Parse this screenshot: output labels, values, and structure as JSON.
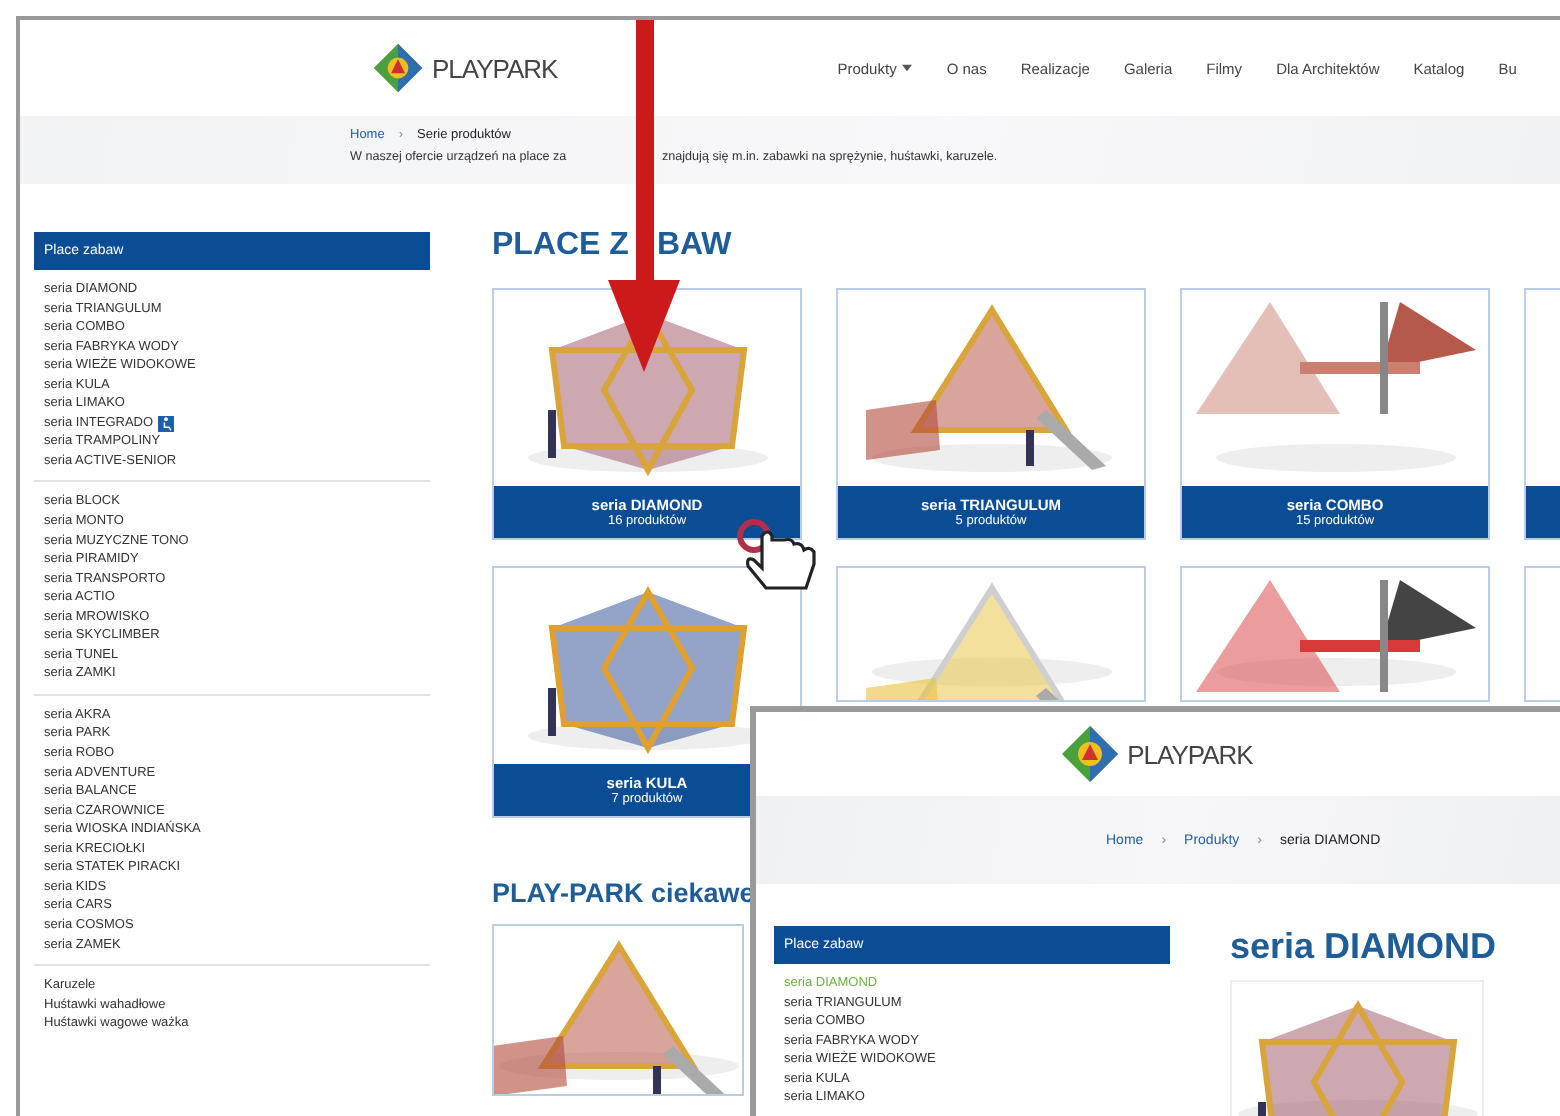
{
  "header": {
    "logo": "**PLAY**PARK",
    "nav": [
      {
        "label": "Produkty",
        "dropdown": true
      },
      {
        "label": "O nas",
        "dropdown": false
      },
      {
        "label": "Realizacje",
        "dropdown": false
      },
      {
        "label": "Galeria",
        "dropdown": false
      },
      {
        "label": "Filmy",
        "dropdown": false
      },
      {
        "label": "Dla Architektów",
        "dropdown": false
      },
      {
        "label": "Katalog",
        "dropdown": false
      },
      {
        "label": "Bu",
        "dropdown": false
      }
    ]
  },
  "breadcrumb": {
    "separator": "›",
    "items": [
      "Home",
      "Serie produktów"
    ]
  },
  "intro": [
    "W naszej ofercie urządzeń na place za",
    "znajdują się m.in. zabawki na sprężynie, huśtawki, karuzele."
  ],
  "sidebar": {
    "title": "Place zabaw",
    "groups": [
      [
        {
          "label": "seria DIAMOND",
          "accessible": false
        },
        {
          "label": "seria TRIANGULUM",
          "accessible": false
        },
        {
          "label": "seria COMBO",
          "accessible": false
        },
        {
          "label": "seria FABRYKA WODY",
          "accessible": false
        },
        {
          "label": "seria WIEŻE WIDOKOWE",
          "accessible": false
        },
        {
          "label": "seria KULA",
          "accessible": false
        },
        {
          "label": "seria LIMAKO",
          "accessible": false
        },
        {
          "label": "seria INTEGRADO",
          "accessible": true
        },
        {
          "label": "seria TRAMPOLINY",
          "accessible": false
        },
        {
          "label": "seria ACTIVE-SENIOR",
          "accessible": false
        }
      ],
      [
        {
          "label": "seria BLOCK",
          "accessible": false
        },
        {
          "label": "seria MONTO",
          "accessible": false
        },
        {
          "label": "seria MUZYCZNE TONO",
          "accessible": false
        },
        {
          "label": "seria PIRAMIDY",
          "accessible": false
        },
        {
          "label": "seria TRANSPORTO",
          "accessible": false
        },
        {
          "label": "seria ACTIO",
          "accessible": false
        },
        {
          "label": "seria MROWISKO",
          "accessible": false
        },
        {
          "label": "seria SKYCLIMBER",
          "accessible": false
        },
        {
          "label": "seria TUNEL",
          "accessible": false
        },
        {
          "label": "seria ZAMKI",
          "accessible": false
        }
      ],
      [
        {
          "label": "seria AKRA",
          "accessible": false
        },
        {
          "label": "seria PARK",
          "accessible": false
        },
        {
          "label": "seria ROBO",
          "accessible": false
        },
        {
          "label": "seria ADVENTURE",
          "accessible": false
        },
        {
          "label": "seria BALANCE",
          "accessible": false
        },
        {
          "label": "seria CZAROWNICE",
          "accessible": false
        },
        {
          "label": "seria WIOSKA INDIAŃSKA",
          "accessible": false
        },
        {
          "label": "seria KRECIOŁKI",
          "accessible": false
        },
        {
          "label": "seria STATEK PIRACKI",
          "accessible": false
        },
        {
          "label": "seria KIDS",
          "accessible": false
        },
        {
          "label": "seria CARS",
          "accessible": false
        },
        {
          "label": "seria COSMOS",
          "accessible": false
        },
        {
          "label": "seria ZAMEK",
          "accessible": false
        }
      ],
      [
        {
          "label": "Karuzele",
          "accessible": false
        },
        {
          "label": "Huśtawki wahadłowe",
          "accessible": false
        },
        {
          "label": "Huśtawki wagowe ważka",
          "accessible": false
        }
      ]
    ]
  },
  "section_title": [
    "PLACE Z",
    "BAW"
  ],
  "cards": [
    {
      "kind": "caption",
      "title": "seria DIAMOND",
      "count": "16 produktów"
    },
    {
      "kind": "caption",
      "title": "seria TRIANGULUM",
      "count": "5 produktów"
    },
    {
      "kind": "caption",
      "title": "seria COMBO",
      "count": "15 produktów"
    },
    {
      "kind": "cut"
    },
    {
      "kind": "caption",
      "title": "seria KULA",
      "count": "7 produktów"
    },
    {
      "kind": "image-only"
    },
    {
      "kind": "image-only"
    },
    {
      "kind": "blank"
    }
  ],
  "section2_title": "PLAY-PARK ciekawe",
  "detail_window": {
    "logo": "**PLAY**PARK",
    "breadcrumb": {
      "separator": "›",
      "items": [
        "Home",
        "Produkty",
        "seria DIAMOND"
      ]
    },
    "sidebar": {
      "title": "Place zabaw",
      "items": [
        {
          "label": "seria DIAMOND",
          "selected": true
        },
        {
          "label": "seria TRIANGULUM",
          "selected": false
        },
        {
          "label": "seria COMBO",
          "selected": false
        },
        {
          "label": "seria FABRYKA WODY",
          "selected": false
        },
        {
          "label": "seria WIEŻE WIDOKOWE",
          "selected": false
        },
        {
          "label": "seria KULA",
          "selected": false
        },
        {
          "label": "seria LIMAKO",
          "selected": false
        }
      ]
    },
    "title": "seria DIAMOND"
  }
}
